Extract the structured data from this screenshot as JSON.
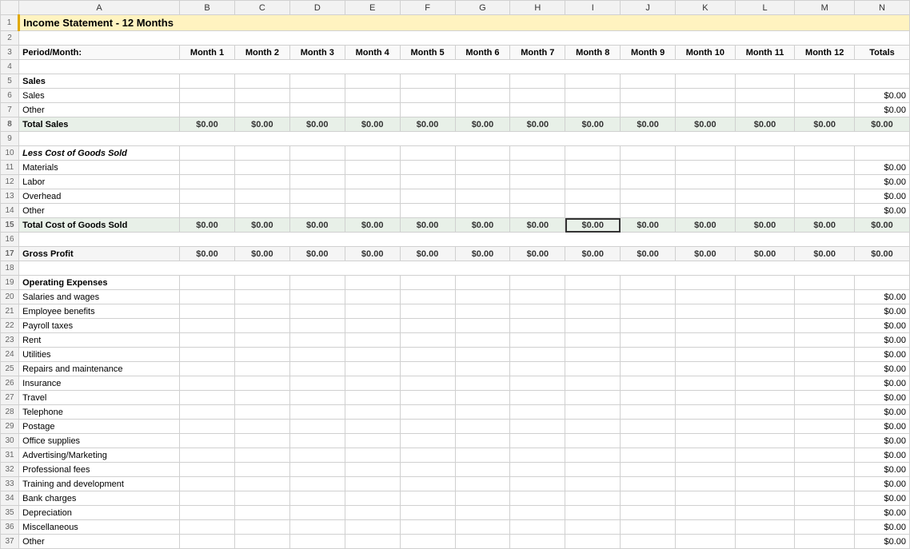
{
  "title": "Income Statement - 12 Months",
  "columns": {
    "row_num_width": 20,
    "label_col": "Period/Month:",
    "months": [
      "Month 1",
      "Month 2",
      "Month 3",
      "Month 4",
      "Month 5",
      "Month 6",
      "Month 7",
      "Month 8",
      "Month 9",
      "Month 10",
      "Month 11",
      "Month 12",
      "Totals"
    ]
  },
  "zero": "$0.00",
  "rows": [
    {
      "num": 1,
      "type": "title",
      "label": "Income Statement - 12 Months"
    },
    {
      "num": 2,
      "type": "empty"
    },
    {
      "num": 3,
      "type": "header"
    },
    {
      "num": 4,
      "type": "empty"
    },
    {
      "num": 5,
      "type": "section",
      "label": "Sales"
    },
    {
      "num": 6,
      "type": "data",
      "label": "Sales",
      "totals": "$0.00"
    },
    {
      "num": 7,
      "type": "data",
      "label": "Other",
      "totals": "$0.00"
    },
    {
      "num": 8,
      "type": "total",
      "label": "Total Sales"
    },
    {
      "num": 9,
      "type": "empty"
    },
    {
      "num": 10,
      "type": "section",
      "label": "Less Cost of Goods Sold",
      "italic": true
    },
    {
      "num": 11,
      "type": "data",
      "label": "Materials",
      "totals": "$0.00"
    },
    {
      "num": 12,
      "type": "data",
      "label": "Labor",
      "totals": "$0.00"
    },
    {
      "num": 13,
      "type": "data",
      "label": "Overhead",
      "totals": "$0.00"
    },
    {
      "num": 14,
      "type": "data",
      "label": "Other",
      "totals": "$0.00"
    },
    {
      "num": 15,
      "type": "total",
      "label": "Total Cost of Goods Sold",
      "selected_col": 8
    },
    {
      "num": 16,
      "type": "empty"
    },
    {
      "num": 17,
      "type": "gross_profit",
      "label": "Gross Profit"
    },
    {
      "num": 18,
      "type": "empty"
    },
    {
      "num": 19,
      "type": "section",
      "label": "Operating Expenses"
    },
    {
      "num": 20,
      "type": "data",
      "label": "Salaries and wages",
      "totals": "$0.00"
    },
    {
      "num": 21,
      "type": "data",
      "label": "Employee benefits",
      "totals": "$0.00"
    },
    {
      "num": 22,
      "type": "data",
      "label": "Payroll taxes",
      "totals": "$0.00"
    },
    {
      "num": 23,
      "type": "data",
      "label": "Rent",
      "totals": "$0.00"
    },
    {
      "num": 24,
      "type": "data",
      "label": "Utilities",
      "totals": "$0.00"
    },
    {
      "num": 25,
      "type": "data",
      "label": "Repairs and maintenance",
      "totals": "$0.00"
    },
    {
      "num": 26,
      "type": "data",
      "label": "Insurance",
      "totals": "$0.00"
    },
    {
      "num": 27,
      "type": "data",
      "label": "Travel",
      "totals": "$0.00"
    },
    {
      "num": 28,
      "type": "data",
      "label": "Telephone",
      "totals": "$0.00"
    },
    {
      "num": 29,
      "type": "data",
      "label": "Postage",
      "totals": "$0.00"
    },
    {
      "num": 30,
      "type": "data",
      "label": "Office supplies",
      "totals": "$0.00"
    },
    {
      "num": 31,
      "type": "data",
      "label": "Advertising/Marketing",
      "totals": "$0.00"
    },
    {
      "num": 32,
      "type": "data",
      "label": "Professional fees",
      "totals": "$0.00"
    },
    {
      "num": 33,
      "type": "data",
      "label": "Training and development",
      "totals": "$0.00"
    },
    {
      "num": 34,
      "type": "data",
      "label": "Bank charges",
      "totals": "$0.00"
    },
    {
      "num": 35,
      "type": "data",
      "label": "Depreciation",
      "totals": "$0.00"
    },
    {
      "num": 36,
      "type": "data",
      "label": "Miscellaneous",
      "totals": "$0.00"
    },
    {
      "num": 37,
      "type": "data",
      "label": "Other",
      "totals": "$0.00"
    }
  ]
}
